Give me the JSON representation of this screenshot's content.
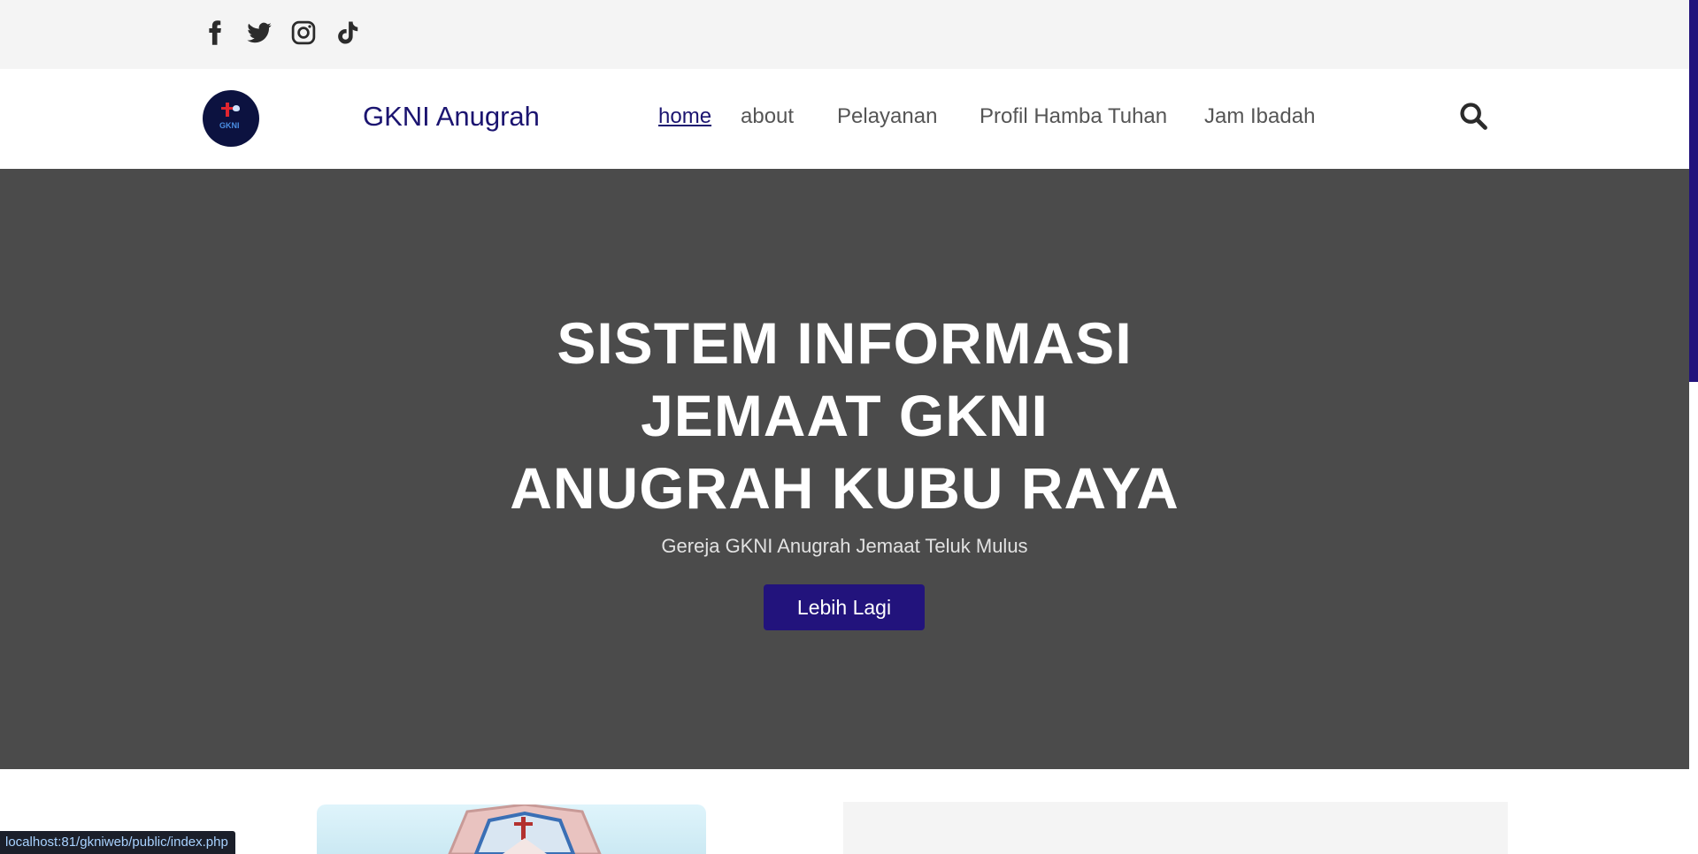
{
  "social": {
    "icons": [
      "facebook-icon",
      "twitter-icon",
      "instagram-icon",
      "tiktok-icon"
    ]
  },
  "navbar": {
    "brand": "GKNI Anugrah",
    "logo_text": "GKNI",
    "links": [
      "home",
      "about",
      "Pelayanan",
      "Profil Hamba Tuhan",
      "Jam Ibadah"
    ],
    "active": "home"
  },
  "hero": {
    "title_lines": [
      "SISTEM INFORMASI",
      "JEMAAT GKNI",
      "ANUGRAH KUBU RAYA"
    ],
    "subtitle": "Gereja GKNI Anugrah Jemaat Teluk Mulus",
    "button_label": "Lebih Lagi"
  },
  "status_bar": {
    "url": "localhost:81/gkniweb/public/index.php"
  },
  "colors": {
    "brand": "#1b1470",
    "button": "#22137c",
    "hero_bg": "#4b4b4b",
    "topbar_bg": "#f4f4f4"
  }
}
